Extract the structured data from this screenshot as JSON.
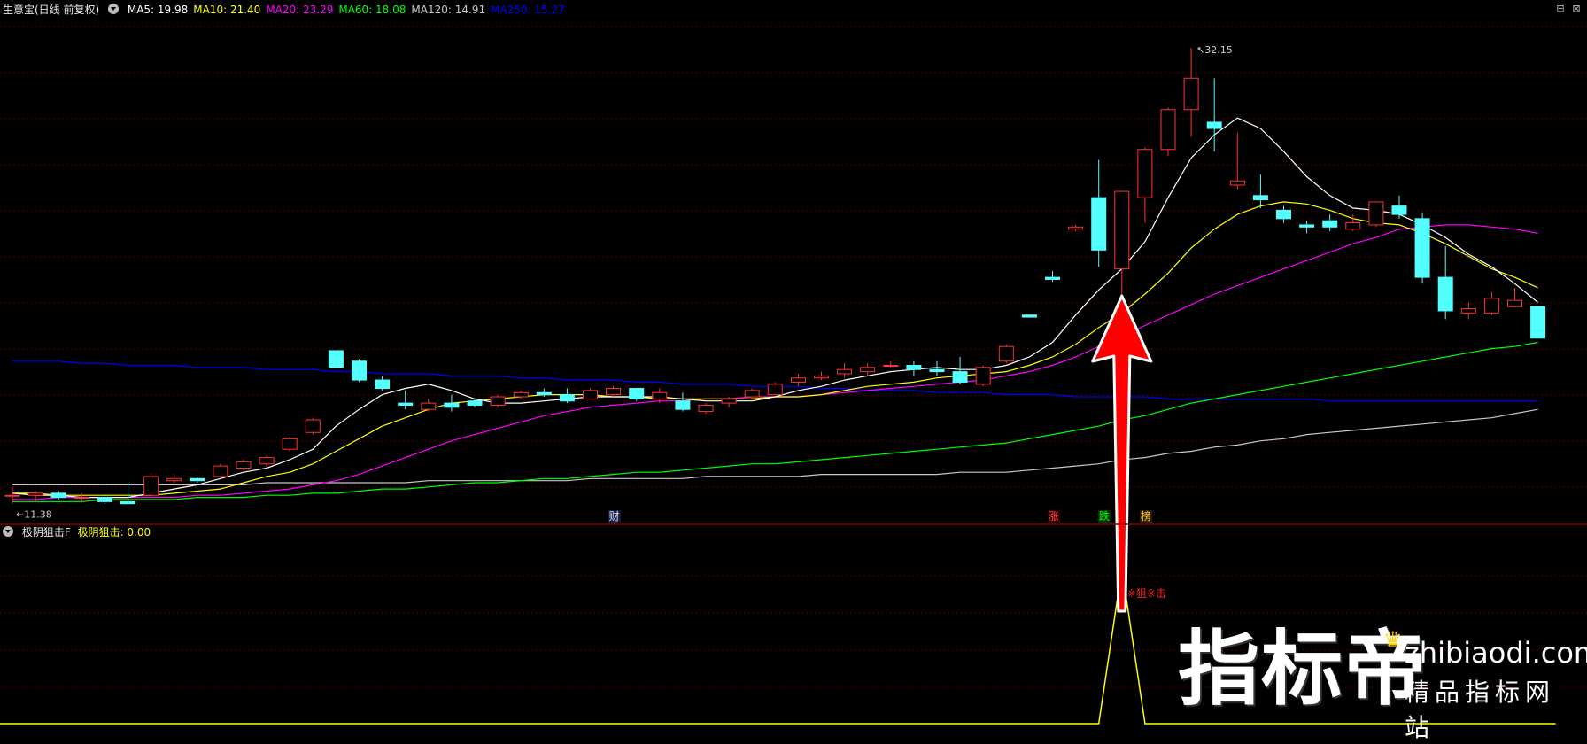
{
  "main_header": {
    "menu_icon": "chevron-down-circle-icon",
    "title": "生意宝(日线 前复权)",
    "ma": [
      {
        "label": "MA5: 19.98",
        "color": "#ffffff"
      },
      {
        "label": "MA10: 21.40",
        "color": "#ffff00"
      },
      {
        "label": "MA20: 23.29",
        "color": "#ff00ff"
      },
      {
        "label": "MA60: 18.08",
        "color": "#00ff00"
      },
      {
        "label": "MA120: 14.91",
        "color": "#c8c8c8"
      },
      {
        "label": "MA250: 15.27",
        "color": "#0000ff"
      }
    ]
  },
  "window_controls": {
    "restore_icon": "⊟",
    "close_icon": "⊠"
  },
  "main_chart": {
    "high_label": "32.15",
    "low_label": "11.38",
    "grid_color": "#5a0000",
    "up_color": "#ff3333",
    "down_color": "#54ffff",
    "candles": [
      [
        10.8,
        11.2,
        10.4,
        10.8
      ],
      [
        10.8,
        11.0,
        10.5,
        10.9
      ],
      [
        10.9,
        11.0,
        10.6,
        10.7
      ],
      [
        10.7,
        10.9,
        10.5,
        10.7
      ],
      [
        10.7,
        10.8,
        10.4,
        10.5
      ],
      [
        10.5,
        10.6,
        11.4,
        10.4
      ],
      [
        10.8,
        11.8,
        10.8,
        11.7
      ],
      [
        11.5,
        11.8,
        11.4,
        11.6
      ],
      [
        11.6,
        11.7,
        11.4,
        11.5
      ],
      [
        11.7,
        12.3,
        11.7,
        12.2
      ],
      [
        12.1,
        12.5,
        12.0,
        12.4
      ],
      [
        12.3,
        12.7,
        12.1,
        12.6
      ],
      [
        13.0,
        13.6,
        12.9,
        13.5
      ],
      [
        13.8,
        14.5,
        13.7,
        14.4
      ],
      [
        17.7,
        17.7,
        16.9,
        16.9
      ],
      [
        17.2,
        17.3,
        16.2,
        16.3
      ],
      [
        16.3,
        16.5,
        15.8,
        15.9
      ],
      [
        15.2,
        15.8,
        14.9,
        15.1
      ],
      [
        14.9,
        15.4,
        14.8,
        15.2
      ],
      [
        15.2,
        15.6,
        14.8,
        15.0
      ],
      [
        15.3,
        15.4,
        15.0,
        15.1
      ],
      [
        15.1,
        15.6,
        15.0,
        15.5
      ],
      [
        15.5,
        15.8,
        15.4,
        15.7
      ],
      [
        15.7,
        15.9,
        15.5,
        15.6
      ],
      [
        15.6,
        15.9,
        15.2,
        15.3
      ],
      [
        15.4,
        15.9,
        15.4,
        15.8
      ],
      [
        15.6,
        16.0,
        15.5,
        15.9
      ],
      [
        15.9,
        15.9,
        15.3,
        15.4
      ],
      [
        15.4,
        15.9,
        15.2,
        15.7
      ],
      [
        15.3,
        15.7,
        14.8,
        14.9
      ],
      [
        14.8,
        15.2,
        14.7,
        15.1
      ],
      [
        15.2,
        15.5,
        15.0,
        15.4
      ],
      [
        15.5,
        15.9,
        15.4,
        15.8
      ],
      [
        15.6,
        16.2,
        15.6,
        16.1
      ],
      [
        16.2,
        16.6,
        16.0,
        16.4
      ],
      [
        16.4,
        16.7,
        16.3,
        16.5
      ],
      [
        16.6,
        17.1,
        16.4,
        16.8
      ],
      [
        16.7,
        17.1,
        16.5,
        16.9
      ],
      [
        17.0,
        17.2,
        16.9,
        17.0
      ],
      [
        17.0,
        17.2,
        16.5,
        16.8
      ],
      [
        16.8,
        17.2,
        16.5,
        16.7
      ],
      [
        16.7,
        17.4,
        16.1,
        16.2
      ],
      [
        16.1,
        17.0,
        16.0,
        16.9
      ],
      [
        17.2,
        18.0,
        17.1,
        17.9
      ],
      [
        19.4,
        19.4,
        19.3,
        19.3
      ],
      [
        21.2,
        21.5,
        21.0,
        21.1
      ],
      [
        23.5,
        23.7,
        23.4,
        23.6
      ],
      [
        25.0,
        26.8,
        21.7,
        22.5
      ],
      [
        21.6,
        25.3,
        17.6,
        25.3
      ],
      [
        25.0,
        27.4,
        23.8,
        27.3
      ],
      [
        27.3,
        29.3,
        27.0,
        29.2
      ],
      [
        29.2,
        32.15,
        27.9,
        30.7
      ],
      [
        28.6,
        30.7,
        27.2,
        28.3
      ],
      [
        25.6,
        28.1,
        25.4,
        25.8
      ],
      [
        25.1,
        26.1,
        24.5,
        24.9
      ],
      [
        24.4,
        24.6,
        23.8,
        24.0
      ],
      [
        23.7,
        23.9,
        23.3,
        23.6
      ],
      [
        23.9,
        24.2,
        23.4,
        23.6
      ],
      [
        23.5,
        24.2,
        23.4,
        23.8
      ],
      [
        23.7,
        24.5,
        23.6,
        24.8
      ],
      [
        24.6,
        25.1,
        24.0,
        24.2
      ],
      [
        24.0,
        24.3,
        20.9,
        21.2
      ],
      [
        21.2,
        22.7,
        19.2,
        19.6
      ],
      [
        19.5,
        20.0,
        19.2,
        19.7
      ],
      [
        19.5,
        20.5,
        19.4,
        20.2
      ],
      [
        19.8,
        20.7,
        19.8,
        20.1
      ],
      [
        19.8,
        19.8,
        18.3,
        18.3
      ]
    ],
    "ma5": [
      10.9,
      10.8,
      10.8,
      10.7,
      10.7,
      10.7,
      10.9,
      11.1,
      11.3,
      11.6,
      11.9,
      12.1,
      12.5,
      13.0,
      14.1,
      14.9,
      15.6,
      15.9,
      16.1,
      15.8,
      15.4,
      15.2,
      15.2,
      15.3,
      15.4,
      15.5,
      15.5,
      15.5,
      15.5,
      15.4,
      15.3,
      15.3,
      15.3,
      15.5,
      15.8,
      16.0,
      16.3,
      16.5,
      16.7,
      16.8,
      16.9,
      16.8,
      16.8,
      17.0,
      17.4,
      18.1,
      19.4,
      20.6,
      21.6,
      22.9,
      25.0,
      26.9,
      28.0,
      28.8,
      28.3,
      27.2,
      26.0,
      25.1,
      24.5,
      24.4,
      24.2,
      23.7,
      23.1,
      22.3,
      21.7,
      20.9,
      20.0
    ],
    "ma10": [
      10.9,
      10.9,
      10.8,
      10.8,
      10.8,
      10.8,
      10.8,
      10.9,
      11.0,
      11.1,
      11.4,
      11.7,
      11.9,
      12.3,
      12.9,
      13.5,
      14.1,
      14.5,
      14.9,
      15.2,
      15.3,
      15.4,
      15.5,
      15.6,
      15.6,
      15.6,
      15.5,
      15.5,
      15.4,
      15.4,
      15.4,
      15.4,
      15.4,
      15.5,
      15.5,
      15.6,
      15.8,
      16.0,
      16.1,
      16.2,
      16.4,
      16.5,
      16.6,
      16.7,
      17.0,
      17.4,
      18.0,
      18.8,
      19.5,
      20.4,
      21.4,
      22.6,
      23.5,
      24.2,
      24.6,
      24.8,
      24.7,
      24.4,
      24.0,
      23.8,
      23.7,
      23.3,
      22.8,
      22.2,
      21.6,
      21.2,
      20.7
    ],
    "ma20": [
      10.6,
      10.6,
      10.7,
      10.7,
      10.7,
      10.7,
      10.7,
      10.7,
      10.8,
      10.8,
      10.9,
      11.0,
      11.1,
      11.3,
      11.5,
      11.8,
      12.2,
      12.6,
      13.0,
      13.4,
      13.7,
      14.0,
      14.3,
      14.6,
      14.8,
      15.0,
      15.1,
      15.2,
      15.3,
      15.3,
      15.4,
      15.4,
      15.5,
      15.5,
      15.5,
      15.6,
      15.7,
      15.8,
      15.9,
      16.0,
      16.1,
      16.2,
      16.3,
      16.5,
      16.7,
      17.0,
      17.4,
      17.9,
      18.4,
      18.9,
      19.4,
      19.9,
      20.4,
      20.8,
      21.2,
      21.6,
      22.0,
      22.4,
      22.8,
      23.1,
      23.5,
      23.6,
      23.7,
      23.7,
      23.6,
      23.5,
      23.3
    ],
    "ma60": [
      10.5,
      10.5,
      10.5,
      10.5,
      10.6,
      10.6,
      10.6,
      10.6,
      10.7,
      10.7,
      10.7,
      10.8,
      10.8,
      10.9,
      10.9,
      11.0,
      11.1,
      11.1,
      11.2,
      11.3,
      11.4,
      11.4,
      11.5,
      11.6,
      11.6,
      11.7,
      11.8,
      11.9,
      11.9,
      12.0,
      12.1,
      12.2,
      12.3,
      12.3,
      12.4,
      12.5,
      12.6,
      12.7,
      12.8,
      12.9,
      13.0,
      13.1,
      13.2,
      13.3,
      13.5,
      13.7,
      13.9,
      14.1,
      14.4,
      14.6,
      14.9,
      15.2,
      15.4,
      15.6,
      15.8,
      16.0,
      16.2,
      16.4,
      16.6,
      16.8,
      17.0,
      17.2,
      17.4,
      17.6,
      17.8,
      17.9,
      18.1
    ],
    "ma120": [
      11.3,
      11.3,
      11.3,
      11.3,
      11.3,
      11.3,
      11.3,
      11.3,
      11.3,
      11.3,
      11.3,
      11.4,
      11.4,
      11.4,
      11.4,
      11.4,
      11.4,
      11.4,
      11.5,
      11.5,
      11.5,
      11.5,
      11.5,
      11.5,
      11.5,
      11.6,
      11.6,
      11.6,
      11.6,
      11.6,
      11.7,
      11.7,
      11.7,
      11.7,
      11.7,
      11.8,
      11.8,
      11.8,
      11.8,
      11.8,
      11.8,
      11.9,
      11.9,
      11.9,
      12.0,
      12.1,
      12.2,
      12.3,
      12.5,
      12.6,
      12.8,
      12.9,
      13.1,
      13.2,
      13.4,
      13.5,
      13.7,
      13.8,
      13.9,
      14.0,
      14.1,
      14.2,
      14.3,
      14.4,
      14.5,
      14.7,
      14.9
    ],
    "ma250": [
      17.2,
      17.2,
      17.2,
      17.1,
      17.1,
      17.0,
      17.0,
      17.0,
      16.9,
      16.9,
      16.9,
      16.8,
      16.8,
      16.8,
      16.7,
      16.7,
      16.6,
      16.6,
      16.6,
      16.5,
      16.5,
      16.5,
      16.4,
      16.4,
      16.3,
      16.3,
      16.3,
      16.2,
      16.2,
      16.1,
      16.1,
      16.1,
      16.0,
      16.0,
      16.0,
      15.9,
      15.9,
      15.8,
      15.8,
      15.8,
      15.7,
      15.7,
      15.7,
      15.6,
      15.6,
      15.6,
      15.5,
      15.5,
      15.5,
      15.5,
      15.4,
      15.4,
      15.4,
      15.4,
      15.4,
      15.4,
      15.4,
      15.3,
      15.3,
      15.3,
      15.3,
      15.3,
      15.3,
      15.3,
      15.3,
      15.3,
      15.3
    ]
  },
  "event_markers": [
    {
      "label": "财",
      "color": "#cfe3ff",
      "bg": "#1a1a40"
    },
    {
      "label": "涨",
      "color": "#ff5050",
      "bg": "#300000"
    },
    {
      "label": "跌",
      "color": "#00ff00",
      "bg": "#003000"
    },
    {
      "label": "榜",
      "color": "#ffcc33",
      "bg": "#301a00"
    }
  ],
  "sub_header": {
    "menu_icon": "chevron-down-circle-icon",
    "indicator_name": "极阴狙击F",
    "value_label": "极阴狙击: 0.00",
    "value_color": "#ffff00"
  },
  "sub_chart": {
    "signal_text": "※狙※击",
    "signal_color": "#ff2020",
    "line_color": "#ffff00",
    "signal_values": [
      0,
      0,
      0,
      0,
      0,
      0,
      0,
      0,
      0,
      0,
      0,
      0,
      0,
      0,
      0,
      0,
      0,
      0,
      0,
      0,
      0,
      0,
      0,
      0,
      0,
      0,
      0,
      0,
      0,
      0,
      0,
      0,
      0,
      0,
      0,
      0,
      0,
      0,
      0,
      0,
      0,
      0,
      0,
      0,
      0,
      0,
      0,
      0,
      1,
      0,
      0,
      0,
      0,
      0,
      0,
      0,
      0,
      0,
      0,
      0,
      0,
      0,
      0,
      0,
      0,
      0,
      0
    ]
  },
  "arrow": {
    "color": "#ff0000",
    "outline": "#ffffff"
  },
  "watermark": {
    "brand_cn": "指标帝",
    "domain": "zhibiaodi.com",
    "tagline": "精品指标网站",
    "crown_icon": "crown-icon"
  }
}
